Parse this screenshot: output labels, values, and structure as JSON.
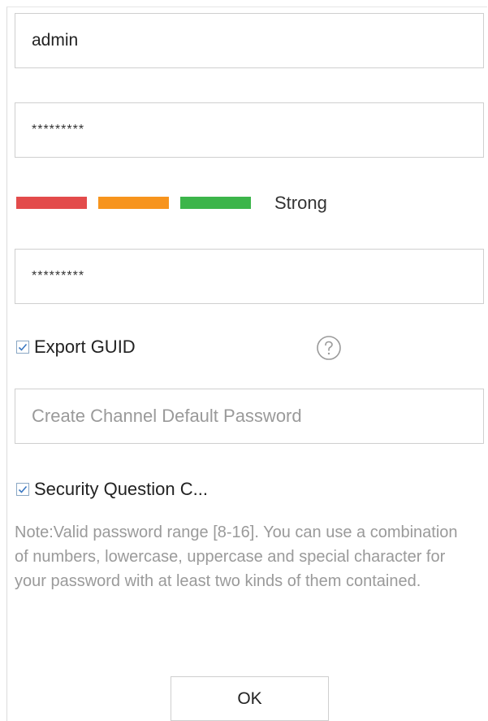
{
  "form": {
    "username_value": "admin",
    "password_value": "*********",
    "strength": {
      "label": "Strong",
      "colors": [
        "#e34b4b",
        "#f7941d",
        "#3cb54a"
      ]
    },
    "confirm_password_value": "*********",
    "export_guid": {
      "label": "Export GUID",
      "checked": true
    },
    "channel_password_placeholder": "Create Channel Default Password",
    "security_question": {
      "label": "Security Question C...",
      "checked": true
    },
    "note": "Note:Valid password range [8-16]. You can use a combination of numbers, lowercase, uppercase and special character for your password with at least two kinds of them contained.",
    "ok_label": "OK"
  },
  "icons": {
    "help": "question-circle-icon",
    "check": "checkmark-icon"
  }
}
